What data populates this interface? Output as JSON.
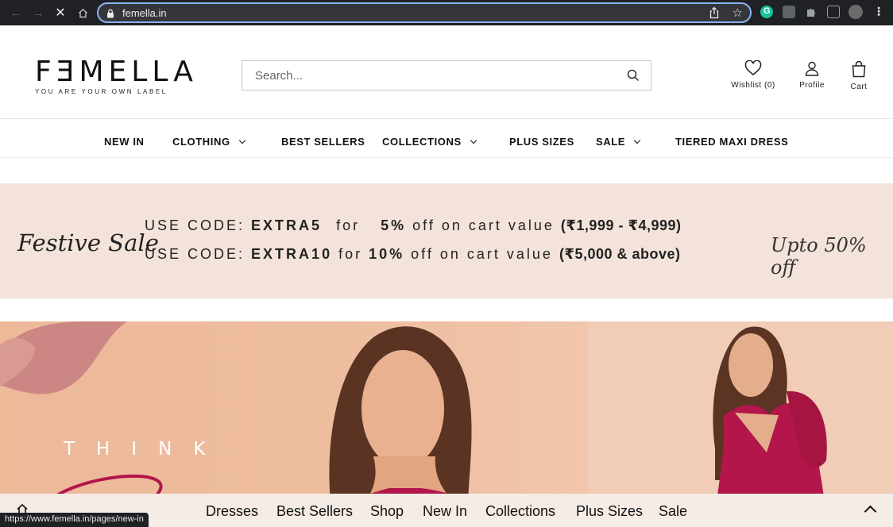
{
  "browser": {
    "url": "femella.in",
    "status_url": "https://www.femella.in/pages/new-in",
    "extension_colors": {
      "grammarly": "#15c39a"
    }
  },
  "header": {
    "logo": "FƎMELLA",
    "tagline": "YOU ARE YOUR OWN LABEL",
    "search_placeholder": "Search...",
    "wishlist_label": "Wishlist (0)",
    "profile_label": "Profile",
    "cart_label": "Cart"
  },
  "nav": {
    "items": [
      {
        "label": "NEW IN",
        "dropdown": false
      },
      {
        "label": "CLOTHING",
        "dropdown": true
      },
      {
        "label": "BEST SELLERS",
        "dropdown": false
      },
      {
        "label": "COLLECTIONS",
        "dropdown": true
      },
      {
        "label": "PLUS SIZES",
        "dropdown": false
      },
      {
        "label": "SALE",
        "dropdown": true
      },
      {
        "label": "TIERED MAXI DRESS",
        "dropdown": false
      }
    ]
  },
  "promo": {
    "left_text": "Festive Sale",
    "right_text": "Upto 50% off",
    "line1": {
      "prefix": "USE CODE:",
      "code": "EXTRA5",
      "for": "for",
      "pct": "5%",
      "suffix": "off on cart value",
      "range": "(₹1,999 - ₹4,999)"
    },
    "line2": {
      "prefix": "USE CODE:",
      "code": "EXTRA10",
      "for": "for",
      "pct": "10%",
      "suffix": "off on cart value",
      "range": "(₹5,000 & above)"
    },
    "background": "#f3e3da"
  },
  "hero": {
    "headline": "THINK",
    "accent_color": "#b2164a"
  },
  "sticky_bar": {
    "links": [
      "Dresses",
      "Best Sellers",
      "Shop",
      "New In",
      "Collections",
      "Plus Sizes",
      "Sale"
    ]
  }
}
